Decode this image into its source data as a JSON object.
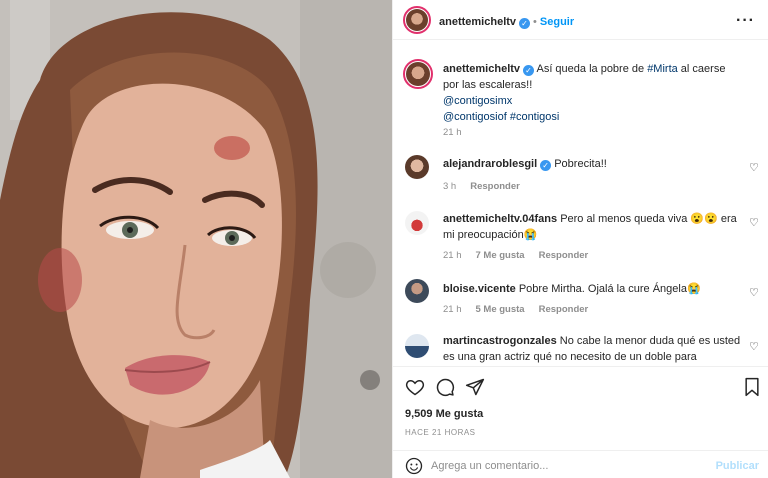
{
  "post": {
    "author": "anettemicheltv",
    "follow_label": "Seguir",
    "dot": "•",
    "more_label": "···",
    "caption": {
      "username": "anettemicheltv",
      "text_before": "Así queda la pobre de ",
      "hashtag": "#Mirta",
      "text_after": " al caerse por las escaleras!!",
      "mention1": "@contigosimx",
      "mention2": "@contigosiof",
      "hashtag2": "#contigosi",
      "time": "21 h"
    },
    "comments": [
      {
        "username": "alejandraroblesgil",
        "verified": true,
        "text": "Pobrecita!!",
        "time": "3 h",
        "likes": "",
        "reply": "Responder"
      },
      {
        "username": "anettemicheltv.04fans",
        "verified": false,
        "text": "Pero al menos queda viva 😮😮 era mi preocupación😭",
        "time": "21 h",
        "likes": "7 Me gusta",
        "reply": "Responder"
      },
      {
        "username": "bloise.vicente",
        "verified": false,
        "text": "Pobre Mirtha. Ojalá la cure Ángela😭",
        "time": "21 h",
        "likes": "5 Me gusta",
        "reply": "Responder"
      },
      {
        "username": "martincastrogonzales",
        "verified": false,
        "text": "No cabe la menor duda qué es usted es una gran actriz qué no necesito de un doble para caracterizar",
        "time": "",
        "likes": "",
        "reply": ""
      }
    ],
    "likes_count": "9,509 Me gusta",
    "posted_ago": "HACE 21 HORAS",
    "add_comment_placeholder": "Agrega un comentario...",
    "publish_label": "Publicar"
  },
  "colors": {
    "accent": "#0095f6",
    "verified": "#3897f0",
    "story_ring": "#e1306c",
    "publish_disabled": "#b2dffc"
  },
  "icons": [
    "heart-icon",
    "comment-icon",
    "share-icon",
    "bookmark-icon",
    "emoji-icon",
    "verified-icon",
    "more-options-icon"
  ]
}
